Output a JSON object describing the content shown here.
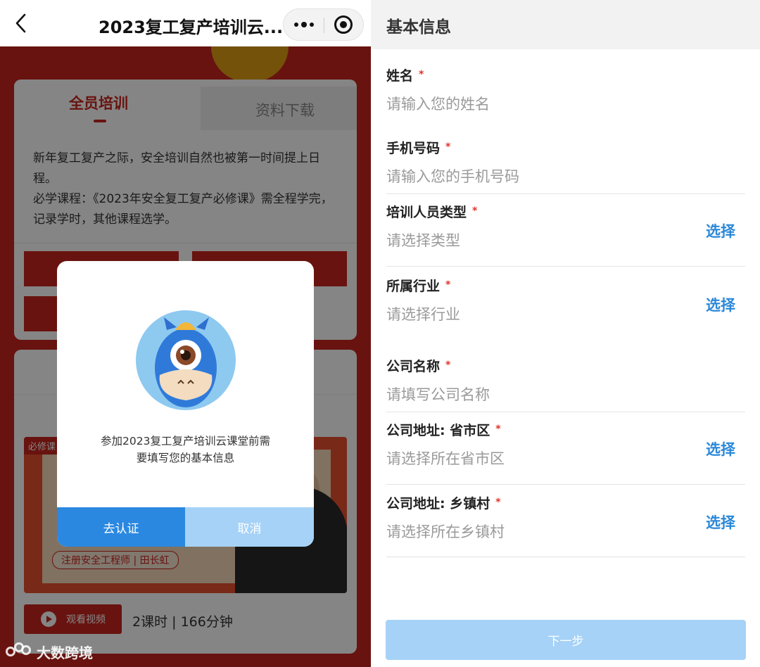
{
  "nav": {
    "title": "2023复工复产培训云..."
  },
  "tabs": {
    "active": "全员培训",
    "inactive": "资料下载"
  },
  "intro": {
    "line1": "新年复工复产之际，安全培训自然也被第一时间提上日程。",
    "line2": "必学课程：《2023年安全复工复产必修课》需全程学完，记录学时，其他课程选学。"
  },
  "course": {
    "tag": "必修课",
    "credit": "注册安全工程师 | 田长虹",
    "watch_label": "观看视频",
    "duration": "2课时 | 166分钟"
  },
  "dialog": {
    "message_line1": "参加2023复工复产培训云课堂前需",
    "message_line2": "要填写您的基本信息",
    "confirm_label": "去认证",
    "cancel_label": "取消"
  },
  "watermark": {
    "text": "大数跨境"
  },
  "form": {
    "title": "基本信息",
    "required_mark": "*",
    "choose_label": "选择",
    "fields": [
      {
        "label": "姓名",
        "placeholder": "请输入您的姓名"
      },
      {
        "label": "手机号码",
        "placeholder": "请输入您的手机号码"
      },
      {
        "label": "培训人员类型",
        "placeholder": "请选择类型"
      },
      {
        "label": "所属行业",
        "placeholder": "请选择行业"
      },
      {
        "label": "公司名称",
        "placeholder": "请填写公司名称"
      },
      {
        "label": "公司地址: 省市区",
        "placeholder": "请选择所在省市区"
      },
      {
        "label": "公司地址: 乡镇村",
        "placeholder": "请选择所在乡镇村"
      }
    ],
    "next_label": "下一步"
  },
  "colors": {
    "brand_red": "#c8261d",
    "primary_blue": "#2b88e0",
    "disabled_blue": "#a6d2f7",
    "link_blue": "#2b88d8",
    "required_red": "#e0332a"
  }
}
